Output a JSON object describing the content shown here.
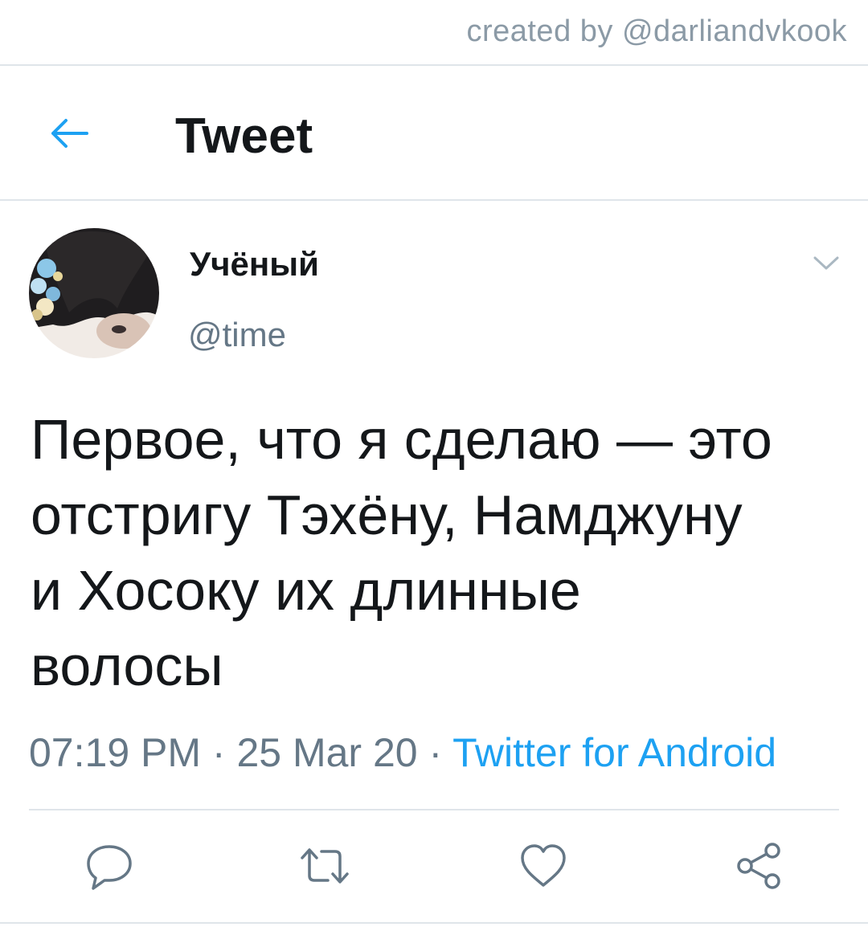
{
  "watermark": "created by @darliandvkook",
  "header": {
    "title": "Tweet",
    "back_icon": "arrow-left-icon"
  },
  "tweet": {
    "author": {
      "display_name": "Учёный",
      "handle": "@time"
    },
    "text_lines": [
      "Первое, что я сделаю — это",
      "отстригу Тэхёну, Намджуну",
      "и Хосоку их длинные",
      "волосы"
    ],
    "time": "07:19 PM",
    "date": "25 Mar 20",
    "separator": " · ",
    "source": "Twitter for Android"
  },
  "actions": [
    {
      "name": "reply",
      "icon": "reply-icon"
    },
    {
      "name": "retweet",
      "icon": "retweet-icon"
    },
    {
      "name": "like",
      "icon": "heart-icon"
    },
    {
      "name": "share",
      "icon": "share-icon"
    }
  ],
  "colors": {
    "accent": "#1da1f2",
    "secondary_text": "#657786",
    "icon": "#657786",
    "divider": "#dfe5ea"
  }
}
